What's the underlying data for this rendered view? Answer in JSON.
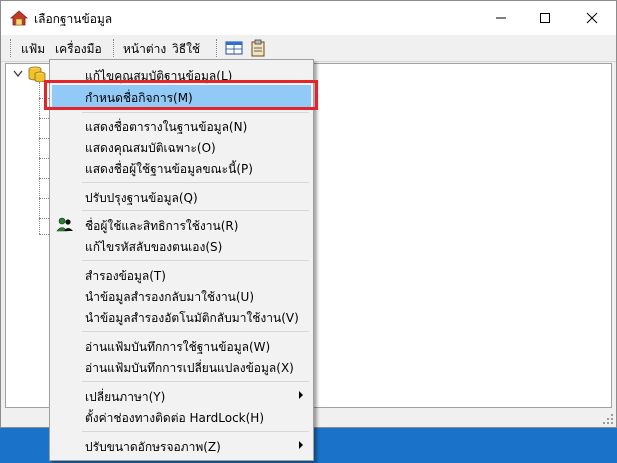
{
  "window": {
    "title": "เลือกฐานข้อมูล",
    "app_icon": "house-db-icon",
    "controls": [
      "minimize-icon",
      "maximize-icon",
      "close-icon"
    ]
  },
  "menubar": {
    "items": [
      "แฟ้ม",
      "เครื่องมือ",
      "หน้าต่าง",
      "วิธีใช้"
    ]
  },
  "toolbar": {
    "icons": [
      "window-grid-icon",
      "clipboard-icon"
    ]
  },
  "colors": {
    "accent_blue": "#1a73c8",
    "highlight": "#91c9f7",
    "emphasis_red": "#e3242b"
  },
  "context_menu": {
    "items": [
      {
        "label": "แก้ไขคุณสมบัติฐานข้อมูล(L)"
      },
      {
        "label": "กำหนดชื่อกิจการ(M)",
        "highlighted": true
      },
      {
        "label": "แสดงชื่อตารางในฐานข้อมูล(N)"
      },
      {
        "label": "แสดงคุณสมบัติเฉพาะ(O)"
      },
      {
        "label": "แสดงชื่อผู้ใช้ฐานข้อมูลขณะนี้(P)"
      },
      {
        "label": "ปรับปรุงฐานข้อมูล(Q)"
      },
      {
        "label": "ชื่อผู้ใช้และสิทธิการใช้งาน(R)",
        "icon": "users-rights-icon"
      },
      {
        "label": "แก้ไขรหัสลับของตนเอง(S)"
      },
      {
        "label": "สำรองข้อมูล(T)"
      },
      {
        "label": "นำข้อมูลสำรองกลับมาใช้งาน(U)"
      },
      {
        "label": "นำข้อมูลสำรองอัตโนมัติกลับมาใช้งาน(V)"
      },
      {
        "label": "อ่านแฟ้มบันทึกการใช้ฐานข้อมูล(W)"
      },
      {
        "label": "อ่านแฟ้มบันทึกการเปลี่ยนแปลงข้อมูล(X)"
      },
      {
        "label": "เปลี่ยนภาษา(Y)",
        "submenu": true
      },
      {
        "label": "ตั้งค่าช่องทางติดต่อ HardLock(H)"
      },
      {
        "label": "ปรับขนาดอักษรจอภาพ(Z)",
        "submenu": true
      }
    ]
  }
}
